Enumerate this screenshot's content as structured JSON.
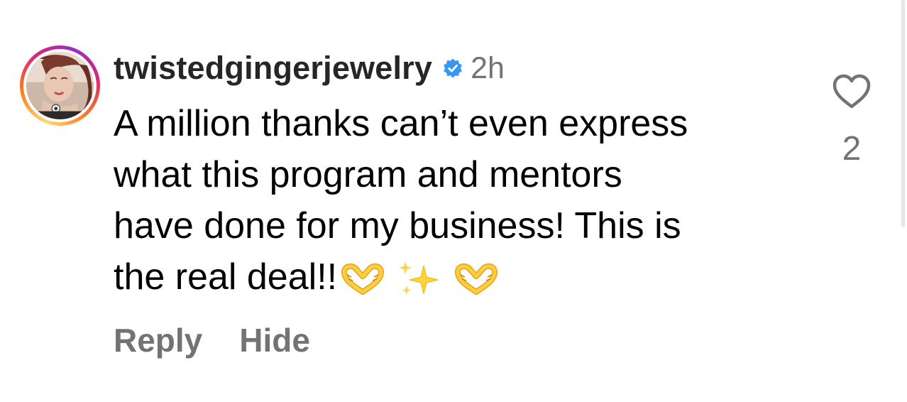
{
  "comment": {
    "username": "twistedgingerjewelry",
    "verified_icon": "verified-badge-icon",
    "time": "2h",
    "text_lines": [
      "A million thanks can’t even express",
      "what this program and mentors",
      "have done for my business! This is",
      "the real deal!!"
    ],
    "emojis": [
      "heart-hands-icon",
      "sparkles-icon",
      "heart-hands-icon"
    ],
    "reply_label": "Reply",
    "hide_label": "Hide",
    "like_icon": "heart-outline-icon",
    "like_count": "2"
  },
  "colors": {
    "primary_text": "#000000",
    "username": "#262626",
    "secondary": "#737373",
    "verified": "#3897f0",
    "ring_gradient": [
      "#feda75",
      "#fa7e1e",
      "#d62976",
      "#962fbf"
    ]
  }
}
